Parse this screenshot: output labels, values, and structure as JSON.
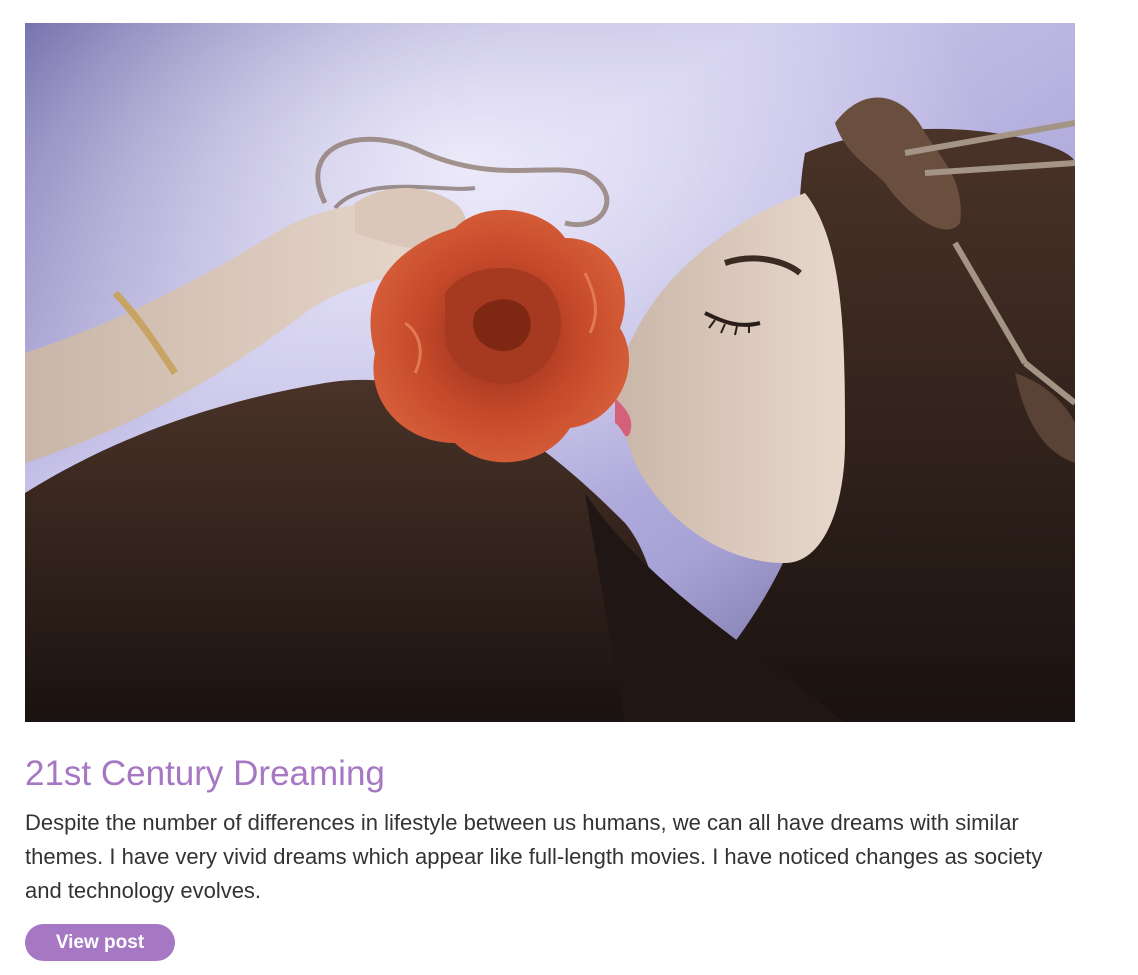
{
  "post": {
    "image_alt": "Woman lying on a bed holding a red rose to her face",
    "title": "21st Century Dreaming",
    "excerpt": "Despite the number of differences in lifestyle between us humans, we can all have dreams with similar themes. I have very vivid dreams which appear like full-length movies. I have noticed changes as society and technology evolves.",
    "button_label": "View post"
  },
  "colors": {
    "accent": "#a678c4",
    "body_text": "#333333",
    "rose": "#c4482a",
    "sheet": "#b9b4dc",
    "hair": "#2a1e1a"
  }
}
